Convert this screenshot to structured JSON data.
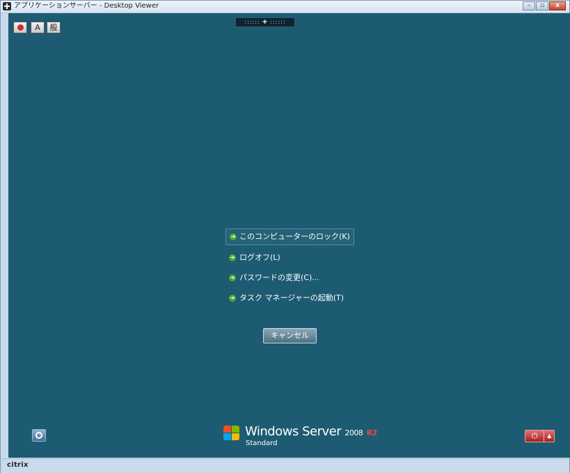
{
  "window": {
    "title": "アプリケーションサーバー - Desktop Viewer",
    "controls": {
      "minimize": "–",
      "restore": "▫",
      "close": "x"
    }
  },
  "toolbar": {
    "button_a": "A",
    "button_ime": "般",
    "handle": ":::::: ✚ ::::::"
  },
  "security_menu": {
    "items": [
      {
        "label": "このコンピューターのロック(K)"
      },
      {
        "label": "ログオフ(L)"
      },
      {
        "label": "パスワードの変更(C)..."
      },
      {
        "label": "タスク マネージャーの起動(T)"
      }
    ],
    "cancel_label": "キャンセル"
  },
  "branding": {
    "product": "Windows Server",
    "version": "2008",
    "release": "R2",
    "edition": "Standard"
  },
  "power": {
    "symbol": "⏻",
    "arrow": "▲"
  },
  "statusbar": {
    "vendor": "citrix"
  },
  "colors": {
    "desktop_background": "#1d5b72",
    "accent_green": "#4fa83a",
    "power_red": "#c43232",
    "r2_red": "#e7483c"
  }
}
